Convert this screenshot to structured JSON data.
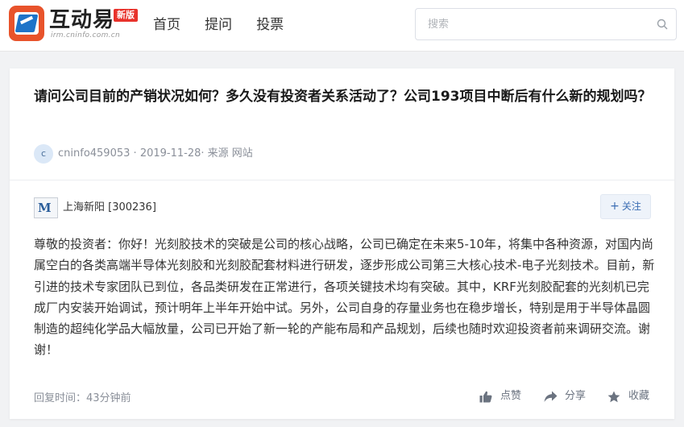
{
  "header": {
    "logo_name": "互动易",
    "logo_url": "irm.cninfo.com.cn",
    "logo_badge": "新版",
    "nav": [
      "首页",
      "提问",
      "投票"
    ],
    "search_placeholder": "搜索"
  },
  "question": {
    "title": "请问公司目前的产销状况如何？多久没有投资者关系活动了？公司193项目中断后有什么新的规划吗？",
    "avatar_letter": "c",
    "author": "cninfo459053",
    "date": "2019-11-28",
    "source": "来源 网站"
  },
  "answer": {
    "company": "上海新阳 [300236]",
    "company_logo_text": "M",
    "follow_label": "关注",
    "text": "尊敬的投资者：你好！光刻胶技术的突破是公司的核心战略，公司已确定在未来5-10年，将集中各种资源，对国内尚属空白的各类高端半导体光刻胶和光刻胶配套材料进行研发，逐步形成公司第三大核心技术-电子光刻技术。目前，新引进的技术专家团队已到位，各品类研发在正常进行，各项关键技术均有突破。其中，KRF光刻胶配套的光刻机已完成厂内安装开始调试，预计明年上半年开始中试。另外，公司自身的存量业务也在稳步增长，特别是用于半导体晶圆制造的超纯化学品大幅放量，公司已开始了新一轮的产能布局和产品规划，后续也随时欢迎投资者前来调研交流。谢谢！",
    "reply_time": "回复时间：43分钟前",
    "actions": {
      "like": "点赞",
      "share": "分享",
      "favorite": "收藏"
    }
  },
  "colors": {
    "brand_red": "#e8532b",
    "accent_blue": "#3c6eb4",
    "text_muted": "#8a8f99"
  }
}
